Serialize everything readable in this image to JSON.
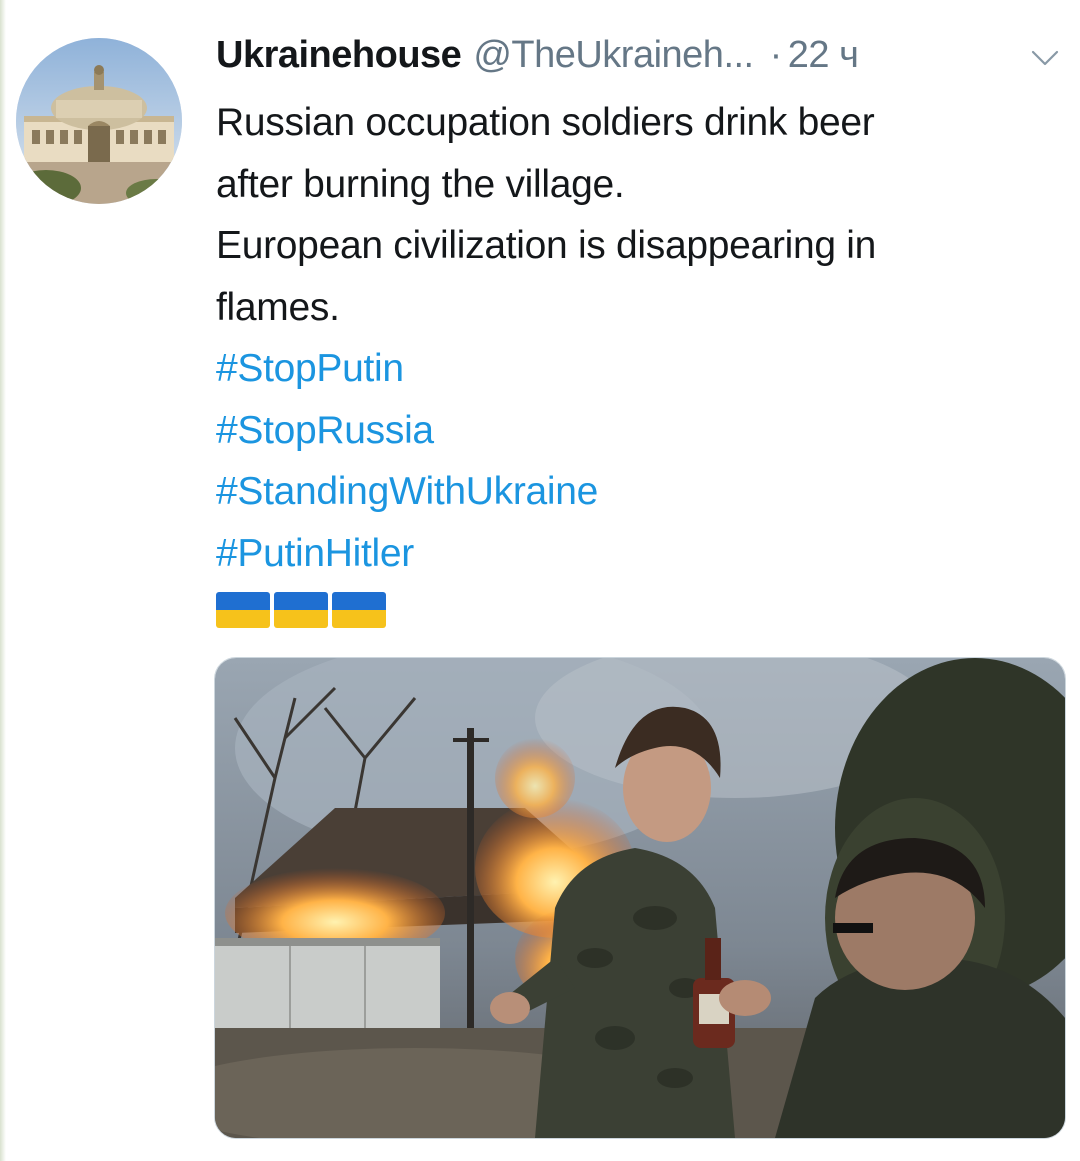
{
  "tweet": {
    "display_name": "Ukrainehouse",
    "handle": "@TheUkraineh...",
    "separator": "·",
    "timestamp": "22 ч",
    "text_lines": [
      "Russian occupation soldiers drink beer",
      "after burning the village.",
      "European civilization is disappearing in",
      "flames."
    ],
    "hashtags": [
      "#StopPutin",
      "#StopRussia",
      "#StandingWithUkraine",
      "#PutinHitler"
    ],
    "emoji": [
      "ukraine-flag",
      "ukraine-flag",
      "ukraine-flag"
    ]
  },
  "colors": {
    "hashtag": "#1b95e0",
    "secondary_text": "#657786",
    "primary_text": "#14171a",
    "flag_blue": "#1f6fd1",
    "flag_yellow": "#f6c21b"
  },
  "icons": {
    "menu": "chevron-down-icon",
    "avatar": "opera-house-photo",
    "media": "burning-village-photo"
  }
}
